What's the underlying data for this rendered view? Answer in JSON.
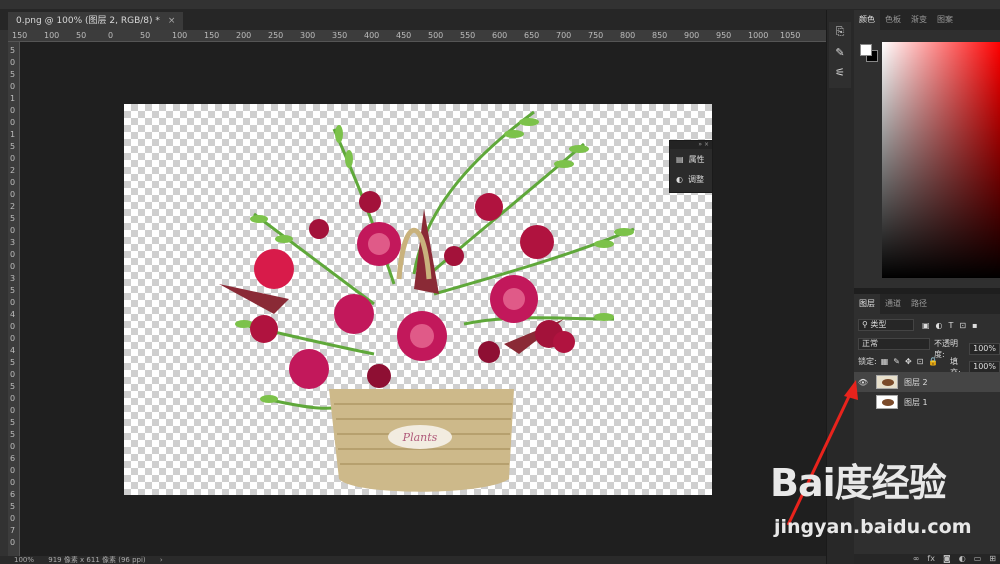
{
  "document_tab": {
    "title": "0.png @ 100% (图层 2, RGB/8) *",
    "close": "×"
  },
  "ruler_h": [
    "150",
    "100",
    "50",
    "0",
    "50",
    "100",
    "150",
    "200",
    "250",
    "300",
    "350",
    "400",
    "450",
    "500",
    "550",
    "600",
    "650",
    "700",
    "750",
    "800",
    "850",
    "900",
    "950",
    "1000",
    "1050"
  ],
  "ruler_v": [
    "5",
    "0",
    "5",
    "0",
    "1",
    "0",
    "0",
    "1",
    "5",
    "0",
    "2",
    "0",
    "0",
    "2",
    "5",
    "0",
    "3",
    "0",
    "0",
    "3",
    "5",
    "0",
    "4",
    "0",
    "0",
    "4",
    "5",
    "0",
    "5",
    "0",
    "0",
    "5",
    "5",
    "0",
    "6",
    "0",
    "0",
    "6",
    "5",
    "0",
    "7",
    "0"
  ],
  "float_panel": {
    "collapse": "» ×",
    "items": [
      {
        "label": "属性",
        "icon": "properties-icon"
      },
      {
        "label": "调整",
        "icon": "adjustments-icon"
      }
    ]
  },
  "status_bar": {
    "zoom": "100%",
    "size": "919 像素 x 611 像素 (96 ppi)",
    "arrow": "›"
  },
  "color_panel": {
    "tabs": [
      "颜色",
      "色板",
      "渐变",
      "图案"
    ],
    "active_tab": 0,
    "fg_color": "#ffffff",
    "bg_color": "#000000"
  },
  "layers_panel": {
    "tabs": [
      "图层",
      "通道",
      "路径"
    ],
    "active_tab": 0,
    "filter_label": "类型",
    "blend_mode": "正常",
    "opacity_label": "不透明度:",
    "opacity_value": "100%",
    "lock_label": "锁定:",
    "fill_label": "填充:",
    "fill_value": "100%",
    "layers": [
      {
        "name": "图层 2",
        "visible": true,
        "selected": true
      },
      {
        "name": "图层 1",
        "visible": false,
        "selected": false
      }
    ],
    "footer_icons": [
      "link-icon",
      "fx-icon",
      "mask-icon",
      "adjustment-layer-icon",
      "group-icon",
      "new-layer-icon"
    ]
  },
  "right_toolbar_icons": [
    "history-icon",
    "brush-settings-icon",
    "adjust-sliders-icon"
  ],
  "watermark": {
    "brand": "Bai度经验",
    "url": "jingyan.baidu.com"
  },
  "accent_colors": {
    "arrow": "#e8231c",
    "rose": "#c2185b",
    "leaf": "#5fa83a",
    "basket": "#cdb98a"
  }
}
